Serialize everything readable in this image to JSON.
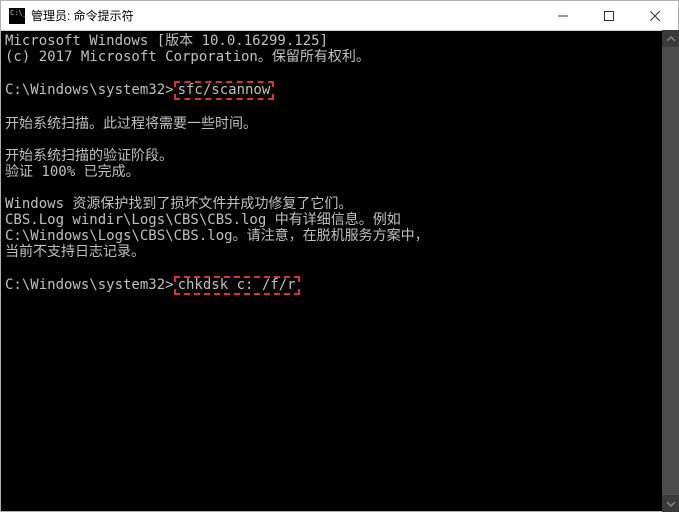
{
  "titlebar": {
    "title": "管理员: 命令提示符"
  },
  "terminal": {
    "line1": "Microsoft Windows [版本 10.0.16299.125]",
    "line2": "(c) 2017 Microsoft Corporation。保留所有权利。",
    "blank1": "",
    "prompt1_prefix": "C:\\Windows\\system32>",
    "cmd1": "sfc/scannow",
    "blank2": "",
    "line3": "开始系统扫描。此过程将需要一些时间。",
    "blank3": "",
    "line4": "开始系统扫描的验证阶段。",
    "line5": "验证 100% 已完成。",
    "blank4": "",
    "line6": "Windows 资源保护找到了损坏文件并成功修复了它们。",
    "line7": "CBS.Log windir\\Logs\\CBS\\CBS.log 中有详细信息。例如",
    "line8": "C:\\Windows\\Logs\\CBS\\CBS.log。请注意，在脱机服务方案中，",
    "line9": "当前不支持日志记录。",
    "blank5": "",
    "prompt2_prefix": "C:\\Windows\\system32>",
    "cmd2": "chkdsk c: /f/r"
  },
  "colors": {
    "highlight_border": "#e03030",
    "terminal_bg": "#000000",
    "terminal_fg": "#c0c0c0",
    "titlebar_bg": "#ffffff"
  },
  "icons": {
    "app": "cmd-icon",
    "minimize": "minimize-icon",
    "maximize": "maximize-icon",
    "close": "close-icon",
    "scroll_up": "chevron-up-icon",
    "scroll_down": "chevron-down-icon"
  }
}
